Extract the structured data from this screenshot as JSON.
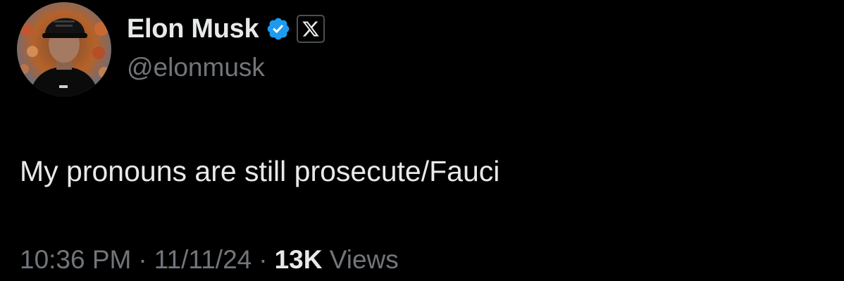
{
  "author": {
    "display_name": "Elon Musk",
    "handle": "@elonmusk",
    "avatar_icon": "profile-photo",
    "verified_icon": "verified-badge-icon",
    "affiliation_icon": "x-logo-icon"
  },
  "tweet": {
    "text": "My pronouns are still prosecute/Fauci"
  },
  "meta": {
    "time": "10:36 PM",
    "separator": "·",
    "date": "11/11/24",
    "views_count": "13K",
    "views_label": "Views"
  },
  "colors": {
    "background": "#000000",
    "primary_text": "#e7e9ea",
    "secondary_text": "#71767b",
    "verified_blue": "#1d9bf0"
  }
}
